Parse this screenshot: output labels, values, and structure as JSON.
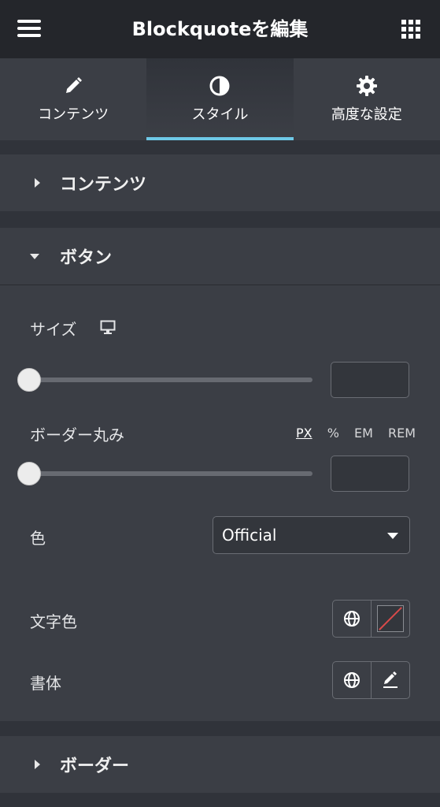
{
  "header": {
    "title": "Blockquoteを編集"
  },
  "tabs": [
    {
      "label": "コンテンツ",
      "icon": "pencil-icon"
    },
    {
      "label": "スタイル",
      "icon": "half-circle-icon",
      "active": true
    },
    {
      "label": "高度な設定",
      "icon": "gear-icon"
    }
  ],
  "sections": {
    "content_title": "コンテンツ",
    "button_title": "ボタン",
    "border_title": "ボーダー"
  },
  "button_panel": {
    "size_label": "サイズ",
    "border_radius_label": "ボーダー丸み",
    "units": [
      "PX",
      "%",
      "EM",
      "REM"
    ],
    "selected_unit": "PX",
    "color_label": "色",
    "color_value": "Official",
    "text_color_label": "文字色",
    "typography_label": "書体",
    "size_value": "",
    "border_radius_value": ""
  },
  "colors": {
    "accent": "#6ec9e7",
    "background": "#30333a",
    "panel": "#3b3e45",
    "header": "#24262b"
  }
}
